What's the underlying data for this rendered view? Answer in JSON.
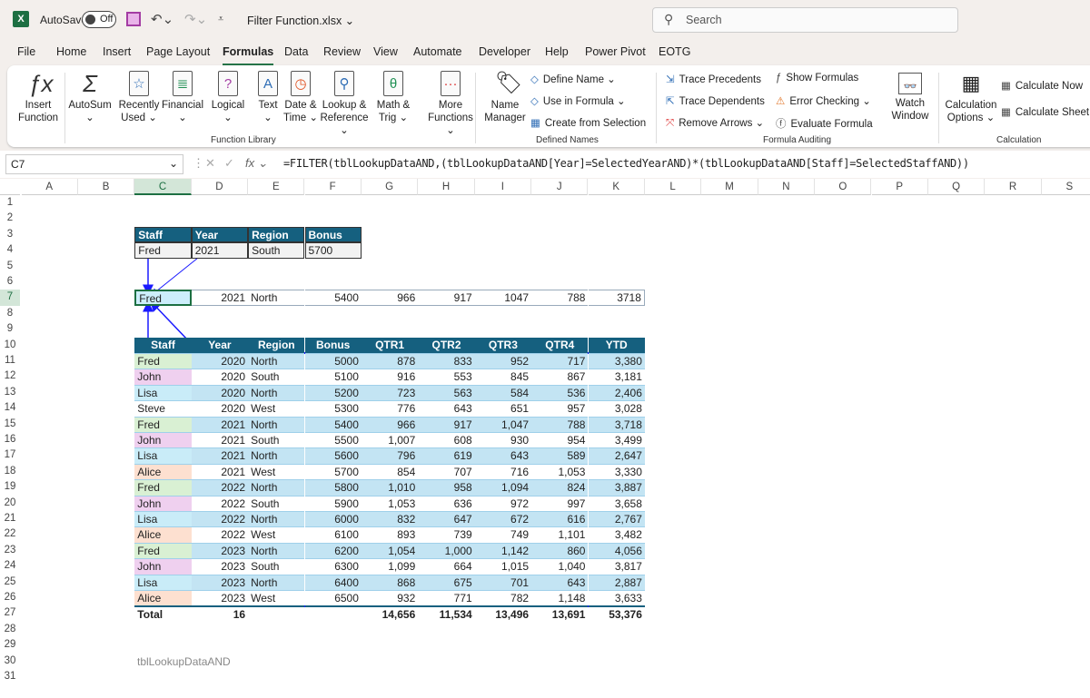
{
  "titlebar": {
    "autosave_label": "AutoSave",
    "autosave_state": "Off",
    "file_name": "Filter Function.xlsx",
    "search_placeholder": "Search"
  },
  "menu_tabs": [
    "File",
    "Home",
    "Insert",
    "Page Layout",
    "Formulas",
    "Data",
    "Review",
    "View",
    "Automate",
    "Developer",
    "Help",
    "Power Pivot",
    "EOTG"
  ],
  "active_tab": "Formulas",
  "ribbon": {
    "function_library": {
      "label": "Function Library",
      "buttons": [
        {
          "l1": "Insert",
          "l2": "Function",
          "icon": "fx-icon"
        },
        {
          "l1": "AutoSum",
          "l2": "⌄",
          "icon": "sigma-icon"
        },
        {
          "l1": "Recently",
          "l2": "Used ⌄",
          "icon": "star-book-icon"
        },
        {
          "l1": "Financial",
          "l2": "⌄",
          "icon": "database-book-icon"
        },
        {
          "l1": "Logical",
          "l2": "⌄",
          "icon": "question-book-icon"
        },
        {
          "l1": "Text",
          "l2": "⌄",
          "icon": "text-book-icon"
        },
        {
          "l1": "Date &",
          "l2": "Time ⌄",
          "icon": "clock-book-icon"
        },
        {
          "l1": "Lookup &",
          "l2": "Reference ⌄",
          "icon": "magnifier-book-icon"
        },
        {
          "l1": "Math &",
          "l2": "Trig ⌄",
          "icon": "theta-book-icon"
        },
        {
          "l1": "More",
          "l2": "Functions ⌄",
          "icon": "more-book-icon"
        }
      ]
    },
    "defined_names": {
      "label": "Defined Names",
      "name_manager_l1": "Name",
      "name_manager_l2": "Manager",
      "items": [
        "Define Name ⌄",
        "Use in Formula ⌄",
        "Create from Selection"
      ]
    },
    "formula_auditing": {
      "label": "Formula Auditing",
      "items": [
        "Trace Precedents",
        "Trace Dependents",
        "Remove Arrows ⌄",
        "Show Formulas",
        "Error Checking ⌄",
        "Evaluate Formula"
      ],
      "watch_l1": "Watch",
      "watch_l2": "Window"
    },
    "calculation": {
      "label": "Calculation",
      "options_l1": "Calculation",
      "options_l2": "Options ⌄",
      "items": [
        "Calculate Now",
        "Calculate Sheet"
      ]
    }
  },
  "formula_bar": {
    "name_box": "C7",
    "formula": "=FILTER(tblLookupDataAND,(tblLookupDataAND[Year]=SelectedYearAND)*(tblLookupDataAND[Staff]=SelectedStaffAND))"
  },
  "columns": [
    "A",
    "B",
    "C",
    "D",
    "E",
    "F",
    "G",
    "H",
    "I",
    "J",
    "K",
    "L",
    "M",
    "N",
    "O",
    "P",
    "Q",
    "R",
    "S"
  ],
  "selected_cell": "C7",
  "criteria_table": {
    "headers": [
      "Staff",
      "Year",
      "Region",
      "Bonus"
    ],
    "row": [
      "Fred",
      "2021",
      "South",
      "5700"
    ]
  },
  "spill_row": [
    "Fred",
    "2021",
    "North",
    "5400",
    "966",
    "917",
    "1047",
    "788",
    "3718"
  ],
  "data_table": {
    "name": "tblLookupDataAND",
    "headers": [
      "Staff",
      "Year",
      "Region",
      "Bonus",
      "QTR1",
      "QTR2",
      "QTR3",
      "QTR4",
      "YTD"
    ],
    "rows": [
      [
        "Fred",
        "2020",
        "North",
        "5000",
        "878",
        "833",
        "952",
        "717",
        "3,380"
      ],
      [
        "John",
        "2020",
        "South",
        "5100",
        "916",
        "553",
        "845",
        "867",
        "3,181"
      ],
      [
        "Lisa",
        "2020",
        "North",
        "5200",
        "723",
        "563",
        "584",
        "536",
        "2,406"
      ],
      [
        "Steve",
        "2020",
        "West",
        "5300",
        "776",
        "643",
        "651",
        "957",
        "3,028"
      ],
      [
        "Fred",
        "2021",
        "North",
        "5400",
        "966",
        "917",
        "1,047",
        "788",
        "3,718"
      ],
      [
        "John",
        "2021",
        "South",
        "5500",
        "1,007",
        "608",
        "930",
        "954",
        "3,499"
      ],
      [
        "Lisa",
        "2021",
        "North",
        "5600",
        "796",
        "619",
        "643",
        "589",
        "2,647"
      ],
      [
        "Alice",
        "2021",
        "West",
        "5700",
        "854",
        "707",
        "716",
        "1,053",
        "3,330"
      ],
      [
        "Fred",
        "2022",
        "North",
        "5800",
        "1,010",
        "958",
        "1,094",
        "824",
        "3,887"
      ],
      [
        "John",
        "2022",
        "South",
        "5900",
        "1,053",
        "636",
        "972",
        "997",
        "3,658"
      ],
      [
        "Lisa",
        "2022",
        "North",
        "6000",
        "832",
        "647",
        "672",
        "616",
        "2,767"
      ],
      [
        "Alice",
        "2022",
        "West",
        "6100",
        "893",
        "739",
        "749",
        "1,101",
        "3,482"
      ],
      [
        "Fred",
        "2023",
        "North",
        "6200",
        "1,054",
        "1,000",
        "1,142",
        "860",
        "4,056"
      ],
      [
        "John",
        "2023",
        "South",
        "6300",
        "1,099",
        "664",
        "1,015",
        "1,040",
        "3,817"
      ],
      [
        "Lisa",
        "2023",
        "North",
        "6400",
        "868",
        "675",
        "701",
        "643",
        "2,887"
      ],
      [
        "Alice",
        "2023",
        "West",
        "6500",
        "932",
        "771",
        "782",
        "1,148",
        "3,633"
      ]
    ],
    "total": [
      "Total",
      "16",
      "",
      "",
      "14,656",
      "11,534",
      "13,496",
      "13,691",
      "53,376"
    ]
  },
  "staff_colors": {
    "Fred": "#d9f0d3",
    "John": "#efd0ef",
    "Lisa": "#c9ecf8",
    "Alice": "#fde0d0",
    "Steve": "#ffffff"
  },
  "colors": {
    "header": "#15607f",
    "band": "#c3e4f3",
    "tracer": "#1a1aff",
    "accent": "#1d6f42"
  }
}
